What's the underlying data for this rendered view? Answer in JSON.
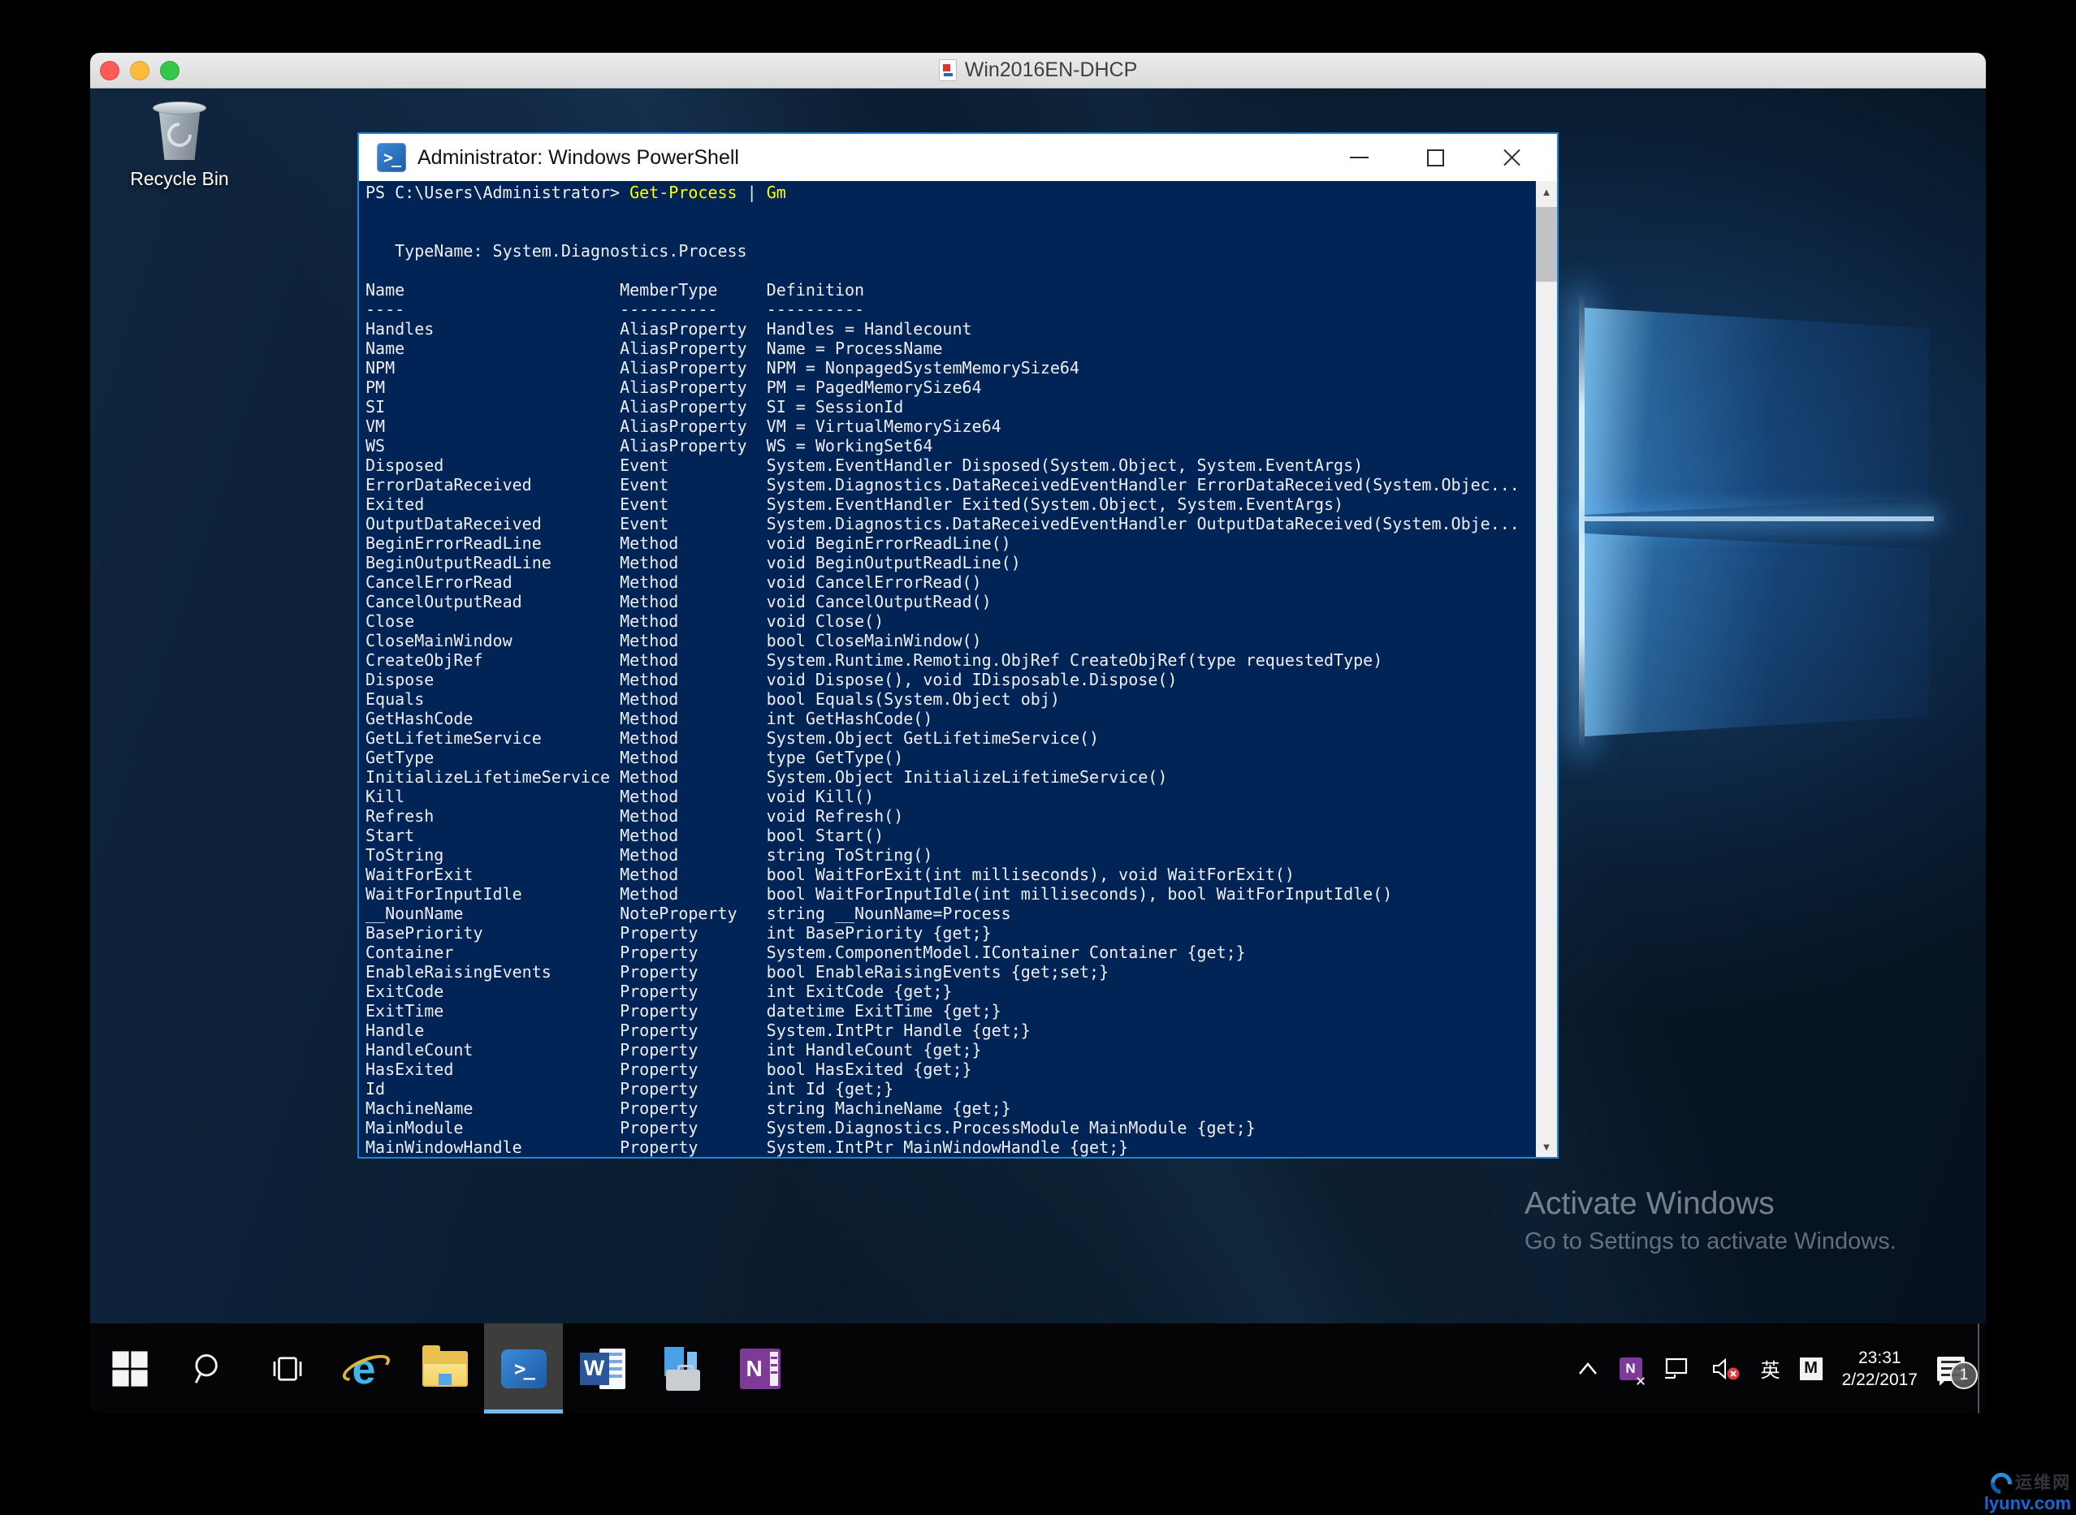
{
  "mac": {
    "window_title": "Win2016EN-DHCP"
  },
  "desktop": {
    "recycle_bin_label": "Recycle Bin",
    "activation": {
      "line1": "Activate Windows",
      "line2": "Go to Settings to activate Windows."
    },
    "watermark": {
      "cn": "运维网",
      "url": "lyunv.com"
    }
  },
  "powershell": {
    "title": "Administrator: Windows PowerShell",
    "prompt": "PS C:\\Users\\Administrator>",
    "command": "Get-Process",
    "pipe": "|",
    "command2": "Gm",
    "typename_line": "   TypeName: System.Diagnostics.Process",
    "columns": [
      "Name",
      "MemberType",
      "Definition"
    ],
    "underline": [
      "----",
      "----------",
      "----------"
    ],
    "members": [
      {
        "name": "Handles",
        "type": "AliasProperty",
        "def": "Handles = Handlecount"
      },
      {
        "name": "Name",
        "type": "AliasProperty",
        "def": "Name = ProcessName"
      },
      {
        "name": "NPM",
        "type": "AliasProperty",
        "def": "NPM = NonpagedSystemMemorySize64"
      },
      {
        "name": "PM",
        "type": "AliasProperty",
        "def": "PM = PagedMemorySize64"
      },
      {
        "name": "SI",
        "type": "AliasProperty",
        "def": "SI = SessionId"
      },
      {
        "name": "VM",
        "type": "AliasProperty",
        "def": "VM = VirtualMemorySize64"
      },
      {
        "name": "WS",
        "type": "AliasProperty",
        "def": "WS = WorkingSet64"
      },
      {
        "name": "Disposed",
        "type": "Event",
        "def": "System.EventHandler Disposed(System.Object, System.EventArgs)"
      },
      {
        "name": "ErrorDataReceived",
        "type": "Event",
        "def": "System.Diagnostics.DataReceivedEventHandler ErrorDataReceived(System.Objec..."
      },
      {
        "name": "Exited",
        "type": "Event",
        "def": "System.EventHandler Exited(System.Object, System.EventArgs)"
      },
      {
        "name": "OutputDataReceived",
        "type": "Event",
        "def": "System.Diagnostics.DataReceivedEventHandler OutputDataReceived(System.Obje..."
      },
      {
        "name": "BeginErrorReadLine",
        "type": "Method",
        "def": "void BeginErrorReadLine()"
      },
      {
        "name": "BeginOutputReadLine",
        "type": "Method",
        "def": "void BeginOutputReadLine()"
      },
      {
        "name": "CancelErrorRead",
        "type": "Method",
        "def": "void CancelErrorRead()"
      },
      {
        "name": "CancelOutputRead",
        "type": "Method",
        "def": "void CancelOutputRead()"
      },
      {
        "name": "Close",
        "type": "Method",
        "def": "void Close()"
      },
      {
        "name": "CloseMainWindow",
        "type": "Method",
        "def": "bool CloseMainWindow()"
      },
      {
        "name": "CreateObjRef",
        "type": "Method",
        "def": "System.Runtime.Remoting.ObjRef CreateObjRef(type requestedType)"
      },
      {
        "name": "Dispose",
        "type": "Method",
        "def": "void Dispose(), void IDisposable.Dispose()"
      },
      {
        "name": "Equals",
        "type": "Method",
        "def": "bool Equals(System.Object obj)"
      },
      {
        "name": "GetHashCode",
        "type": "Method",
        "def": "int GetHashCode()"
      },
      {
        "name": "GetLifetimeService",
        "type": "Method",
        "def": "System.Object GetLifetimeService()"
      },
      {
        "name": "GetType",
        "type": "Method",
        "def": "type GetType()"
      },
      {
        "name": "InitializeLifetimeService",
        "type": "Method",
        "def": "System.Object InitializeLifetimeService()"
      },
      {
        "name": "Kill",
        "type": "Method",
        "def": "void Kill()"
      },
      {
        "name": "Refresh",
        "type": "Method",
        "def": "void Refresh()"
      },
      {
        "name": "Start",
        "type": "Method",
        "def": "bool Start()"
      },
      {
        "name": "ToString",
        "type": "Method",
        "def": "string ToString()"
      },
      {
        "name": "WaitForExit",
        "type": "Method",
        "def": "bool WaitForExit(int milliseconds), void WaitForExit()"
      },
      {
        "name": "WaitForInputIdle",
        "type": "Method",
        "def": "bool WaitForInputIdle(int milliseconds), bool WaitForInputIdle()"
      },
      {
        "name": "__NounName",
        "type": "NoteProperty",
        "def": "string __NounName=Process"
      },
      {
        "name": "BasePriority",
        "type": "Property",
        "def": "int BasePriority {get;}"
      },
      {
        "name": "Container",
        "type": "Property",
        "def": "System.ComponentModel.IContainer Container {get;}"
      },
      {
        "name": "EnableRaisingEvents",
        "type": "Property",
        "def": "bool EnableRaisingEvents {get;set;}"
      },
      {
        "name": "ExitCode",
        "type": "Property",
        "def": "int ExitCode {get;}"
      },
      {
        "name": "ExitTime",
        "type": "Property",
        "def": "datetime ExitTime {get;}"
      },
      {
        "name": "Handle",
        "type": "Property",
        "def": "System.IntPtr Handle {get;}"
      },
      {
        "name": "HandleCount",
        "type": "Property",
        "def": "int HandleCount {get;}"
      },
      {
        "name": "HasExited",
        "type": "Property",
        "def": "bool HasExited {get;}"
      },
      {
        "name": "Id",
        "type": "Property",
        "def": "int Id {get;}"
      },
      {
        "name": "MachineName",
        "type": "Property",
        "def": "string MachineName {get;}"
      },
      {
        "name": "MainModule",
        "type": "Property",
        "def": "System.Diagnostics.ProcessModule MainModule {get;}"
      },
      {
        "name": "MainWindowHandle",
        "type": "Property",
        "def": "System.IntPtr MainWindowHandle {get;}"
      }
    ]
  },
  "taskbar": {
    "word_letter": "W",
    "onenote_letter": "N",
    "ie_letter": "e",
    "ps_prompt_glyph": ">_"
  },
  "tray": {
    "lang": "英",
    "ime": "M",
    "onenote_clip_letter": "N",
    "time": "23:31",
    "date": "2/22/2017",
    "badge": "1"
  },
  "colors": {
    "accent_border": "#1c86dd",
    "console_bg": "#012456",
    "command_highlight": "#ffff00",
    "taskbar_active_underline": "#76b9ed"
  }
}
